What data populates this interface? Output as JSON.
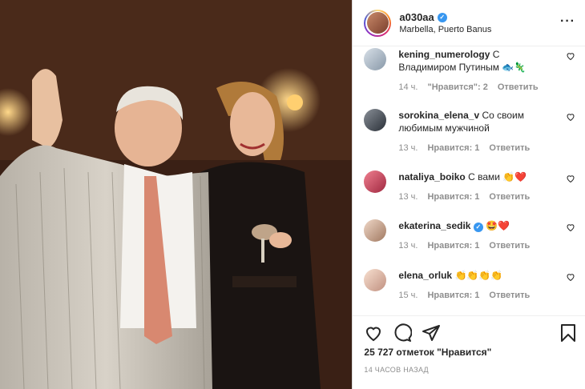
{
  "post": {
    "username": "a030aa",
    "location": "Marbella, Puerto Banus",
    "more_label": "···"
  },
  "comments": [
    {
      "user": "kening_numerology",
      "text": "С Владимиром Путиным 🐟🦎",
      "time": "14 ч.",
      "likes": "\"Нравится\": 2",
      "reply": "Ответить",
      "avatar_color": "#a8b8c8"
    },
    {
      "user": "sorokina_elena_v",
      "text": "Со своим любимым мужчиной",
      "time": "13 ч.",
      "likes": "Нравится: 1",
      "reply": "Ответить",
      "avatar_color": "#5a6068"
    },
    {
      "user": "nataliya_boiko",
      "text": "С вами 👏❤️",
      "time": "13 ч.",
      "likes": "Нравится: 1",
      "reply": "Ответить",
      "avatar_color": "#d04860"
    },
    {
      "user": "ekaterina_sedik",
      "text": "🤩❤️",
      "time": "13 ч.",
      "likes": "Нравится: 1",
      "reply": "Ответить",
      "avatar_color": "#c8a890",
      "verified": true
    },
    {
      "user": "elena_orluk",
      "text": "👏👏👏👏",
      "time": "15 ч.",
      "likes": "Нравится: 1",
      "reply": "Ответить",
      "avatar_color": "#d8b8a8"
    }
  ],
  "likes_text": "25 727 отметок \"Нравится\"",
  "time_ago": "14 ЧАСОВ НАЗАД",
  "colors": {
    "brand_gradient": [
      "#feda75",
      "#fa7e1e",
      "#d62976",
      "#962fbf",
      "#4f5bd5"
    ],
    "verified": "#3897f0",
    "heart": "#ed4956"
  },
  "icons": [
    "heart-icon",
    "comment-icon",
    "share-icon",
    "bookmark-icon",
    "more-icon",
    "verified-icon"
  ]
}
